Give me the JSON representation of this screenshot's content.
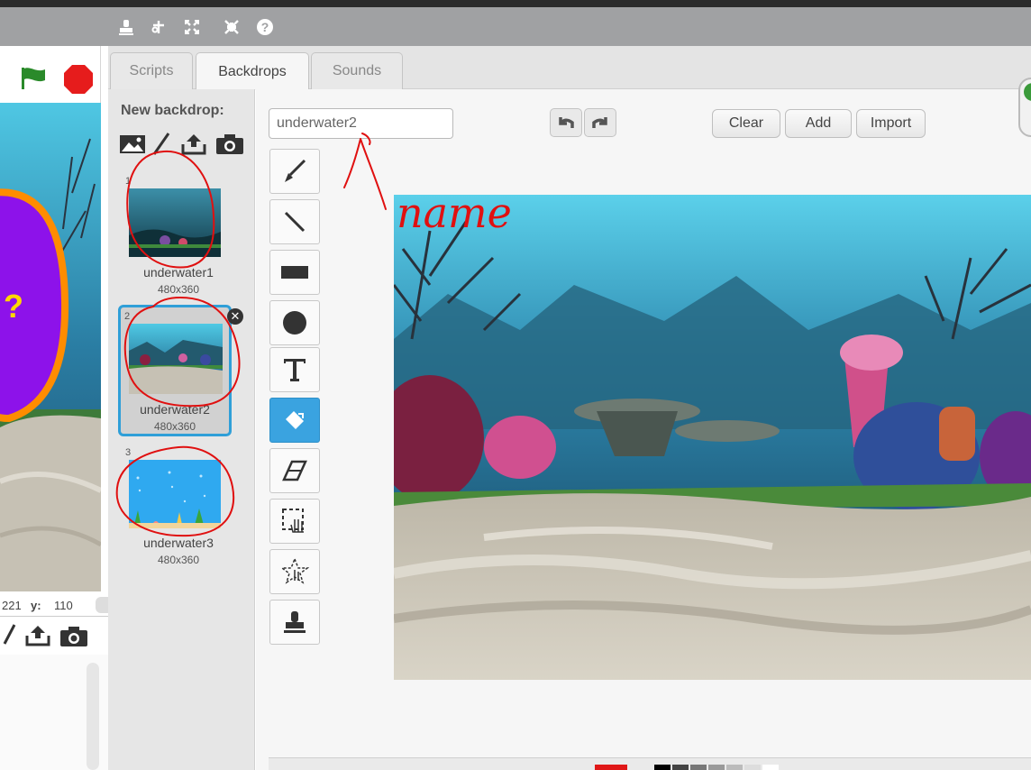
{
  "tabs": [
    {
      "label": "Scripts"
    },
    {
      "label": "Backdrops"
    },
    {
      "label": "Sounds"
    }
  ],
  "new_backdrop": {
    "label": "New backdrop:"
  },
  "backdrops": [
    {
      "number": "1",
      "name": "underwater1",
      "size": "480x360"
    },
    {
      "number": "2",
      "name": "underwater2",
      "size": "480x360"
    },
    {
      "number": "3",
      "name": "underwater3",
      "size": "480x360"
    }
  ],
  "editor": {
    "name_value": "underwater2",
    "clear_label": "Clear",
    "add_label": "Add",
    "import_label": "Import"
  },
  "stage": {
    "x_value": "221",
    "y_label": "y:",
    "y_value": "110",
    "speech_text": "?"
  },
  "annotation": {
    "text": "name"
  },
  "colors": {
    "toolbar": "#a0a1a3",
    "selection": "#2f9fd8",
    "active_tool": "#3aa3e0",
    "annotation_red": "#e01010",
    "green_flag": "#2a8a2a",
    "stop": "#e61c1c"
  }
}
